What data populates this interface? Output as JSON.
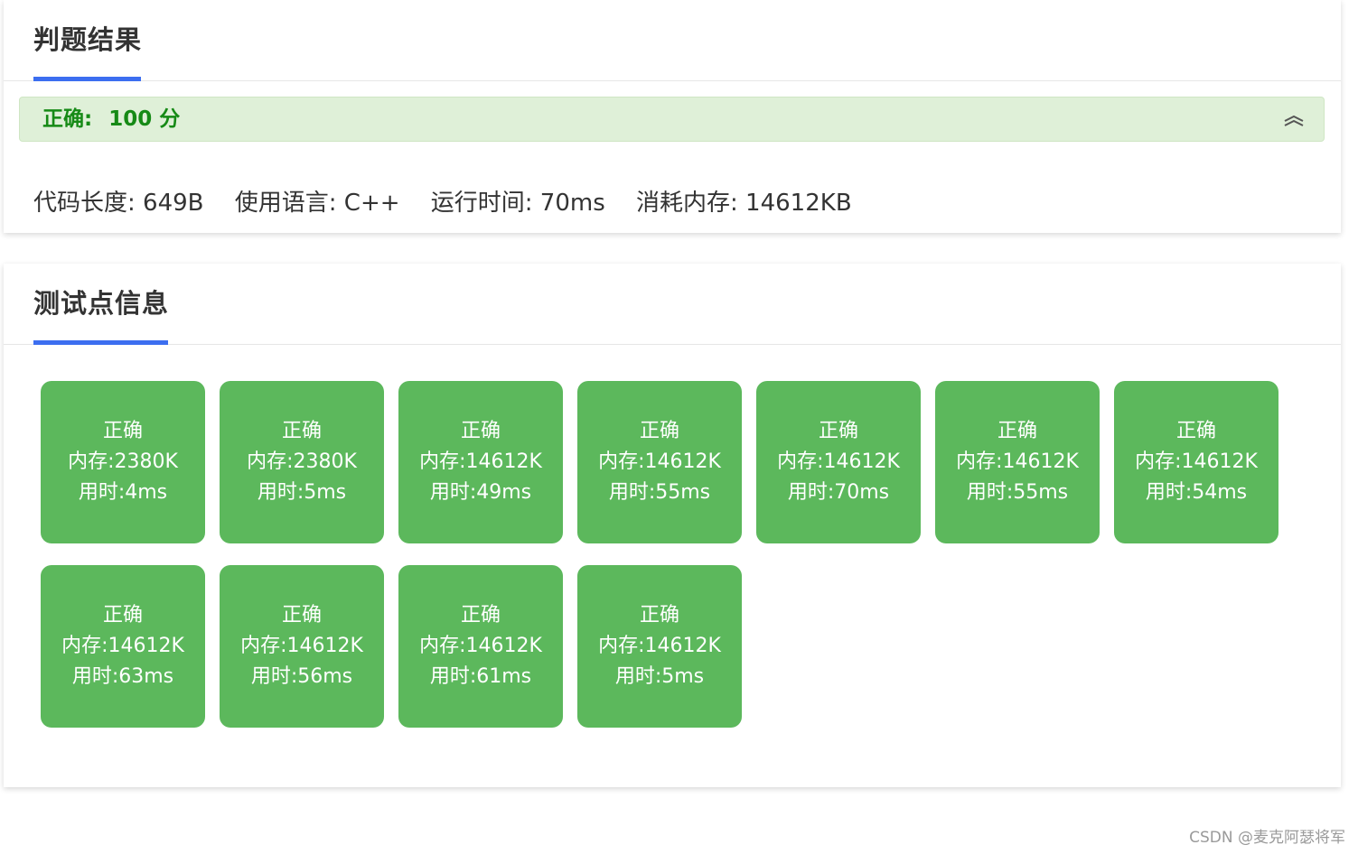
{
  "result_card": {
    "title": "判题结果",
    "verdict_label": "正确:",
    "verdict_score": "100 分",
    "stats": {
      "code_length": "代码长度: 649B",
      "language": "使用语言: C++",
      "run_time": "运行时间: 70ms",
      "memory": "消耗内存: 14612KB"
    }
  },
  "tests_card": {
    "title": "测试点信息",
    "tests": [
      {
        "status": "正确",
        "memory": "内存:2380K",
        "time": "用时:4ms"
      },
      {
        "status": "正确",
        "memory": "内存:2380K",
        "time": "用时:5ms"
      },
      {
        "status": "正确",
        "memory": "内存:14612K",
        "time": "用时:49ms"
      },
      {
        "status": "正确",
        "memory": "内存:14612K",
        "time": "用时:55ms"
      },
      {
        "status": "正确",
        "memory": "内存:14612K",
        "time": "用时:70ms"
      },
      {
        "status": "正确",
        "memory": "内存:14612K",
        "time": "用时:55ms"
      },
      {
        "status": "正确",
        "memory": "内存:14612K",
        "time": "用时:54ms"
      },
      {
        "status": "正确",
        "memory": "内存:14612K",
        "time": "用时:63ms"
      },
      {
        "status": "正确",
        "memory": "内存:14612K",
        "time": "用时:56ms"
      },
      {
        "status": "正确",
        "memory": "内存:14612K",
        "time": "用时:61ms"
      },
      {
        "status": "正确",
        "memory": "内存:14612K",
        "time": "用时:5ms"
      }
    ]
  },
  "watermark": "CSDN @麦克阿瑟将军",
  "colors": {
    "accent": "#3c6ef0",
    "success_bg": "#dff0d8",
    "success_text": "#168a16",
    "tile_green": "#5cb85c"
  },
  "icons": {
    "collapse": "chevron-double-up-icon"
  }
}
